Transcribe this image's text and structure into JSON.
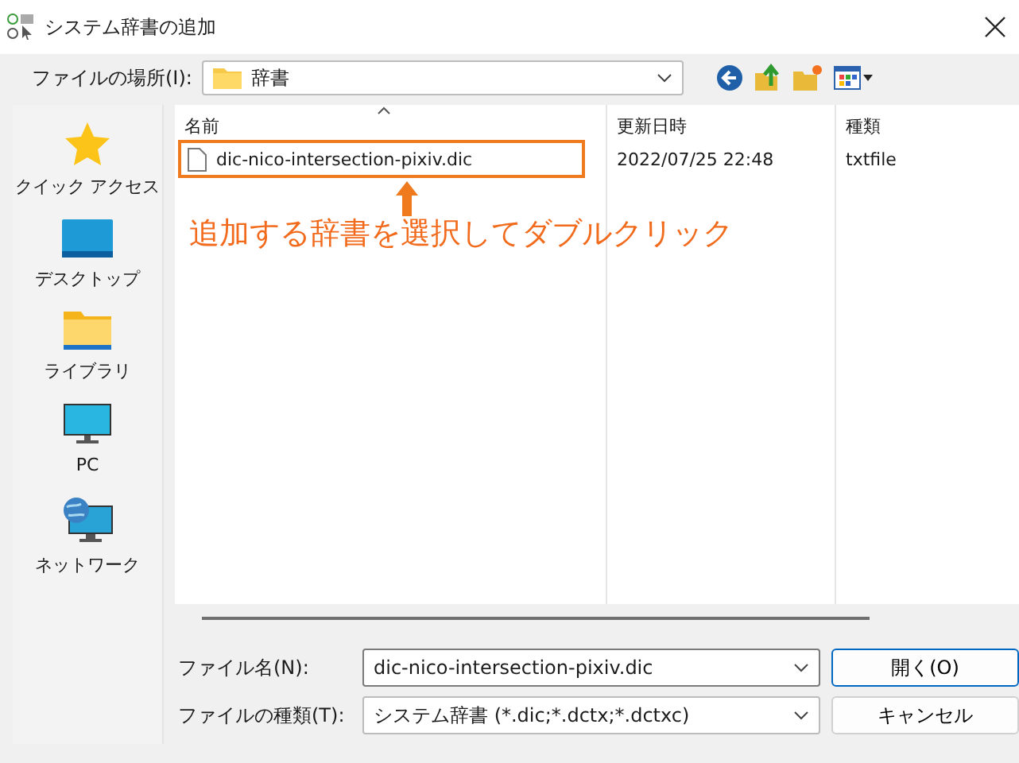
{
  "window": {
    "title": "システム辞書の追加"
  },
  "location": {
    "label": "ファイルの場所(I):",
    "value": "辞書"
  },
  "sidebar": {
    "items": [
      {
        "label": "クイック アクセス",
        "kind": "star"
      },
      {
        "label": "デスクトップ",
        "kind": "desktop"
      },
      {
        "label": "ライブラリ",
        "kind": "library"
      },
      {
        "label": "PC",
        "kind": "pc"
      },
      {
        "label": "ネットワーク",
        "kind": "network"
      }
    ]
  },
  "table": {
    "columns": [
      {
        "label": "名前",
        "sorted": true
      },
      {
        "label": "更新日時",
        "sorted": false
      },
      {
        "label": "種類",
        "sorted": false
      }
    ],
    "rows": [
      {
        "name": "dic-nico-intersection-pixiv.dic",
        "modified": "2022/07/25 22:48",
        "type": "txtfile",
        "highlighted": true
      }
    ]
  },
  "annotation": {
    "text": "追加する辞書を選択してダブルクリック"
  },
  "filename": {
    "label": "ファイル名(N):",
    "value": "dic-nico-intersection-pixiv.dic"
  },
  "filetype": {
    "label": "ファイルの種類(T):",
    "value": "システム辞書 (*.dic;*.dctx;*.dctxc)"
  },
  "buttons": [
    {
      "label": "開く(O)",
      "kind": "primary"
    },
    {
      "label": "キャンセル",
      "kind": "secondary"
    }
  ]
}
